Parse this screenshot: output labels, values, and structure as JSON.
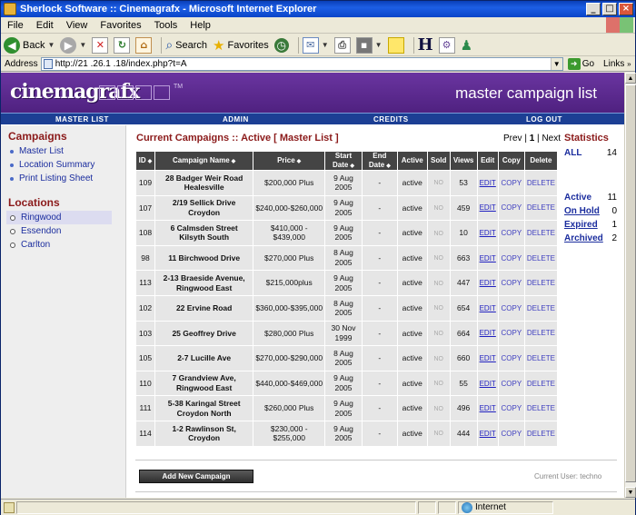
{
  "window": {
    "title": "Sherlock Software :: Cinemagrafx - Microsoft Internet Explorer"
  },
  "menu": [
    "File",
    "Edit",
    "View",
    "Favorites",
    "Tools",
    "Help"
  ],
  "toolbar": {
    "back_label": "Back",
    "search_label": "Search",
    "favorites_label": "Favorites"
  },
  "address": {
    "label": "Address",
    "url": "http://21  .26.1    .18/index.php?t=A",
    "go_label": "Go",
    "links_label": "Links"
  },
  "header": {
    "logo": "cinemagrafx",
    "tm": "TM",
    "page_title": "master campaign list"
  },
  "nav": {
    "master_list": "MASTER LIST",
    "admin": "ADMIN",
    "credits": "CREDITS",
    "logout": "LOG OUT"
  },
  "sidebar": {
    "campaigns_heading": "Campaigns",
    "campaign_links": [
      "Master List",
      "Location Summary",
      "Print Listing Sheet"
    ],
    "locations_heading": "Locations",
    "locations": [
      "Ringwood",
      "Essendon",
      "Carlton"
    ]
  },
  "main": {
    "title": "Current Campaigns :: Active [ Master List ]",
    "pager": {
      "prev": "Prev",
      "sep1": " | ",
      "current": "1",
      "sep2": " | ",
      "next": "Next"
    },
    "columns": [
      "ID",
      "Campaign Name",
      "Price",
      "Start Date",
      "End Date",
      "Active",
      "Sold",
      "Views",
      "Edit",
      "Copy",
      "Delete"
    ],
    "rows": [
      {
        "id": "109",
        "name": "28 Badger Weir Road Healesville",
        "price": "$200,000 Plus",
        "start": "9 Aug 2005",
        "end": "-",
        "active": "active",
        "sold": "NO",
        "views": "53"
      },
      {
        "id": "107",
        "name": "2/19 Sellick Drive Croydon",
        "price": "$240,000-$260,000",
        "start": "9 Aug 2005",
        "end": "-",
        "active": "active",
        "sold": "NO",
        "views": "459"
      },
      {
        "id": "108",
        "name": "6 Calmsden Street Kilsyth South",
        "price": "$410,000 - $439,000",
        "start": "9 Aug 2005",
        "end": "-",
        "active": "active",
        "sold": "NO",
        "views": "10"
      },
      {
        "id": "98",
        "name": "11 Birchwood Drive",
        "price": "$270,000 Plus",
        "start": "8 Aug 2005",
        "end": "-",
        "active": "active",
        "sold": "NO",
        "views": "663"
      },
      {
        "id": "113",
        "name": "2-13 Braeside Avenue, Ringwood East",
        "price": "$215,000plus",
        "start": "9 Aug 2005",
        "end": "-",
        "active": "active",
        "sold": "NO",
        "views": "447"
      },
      {
        "id": "102",
        "name": "22 Ervine Road",
        "price": "$360,000-$395,000",
        "start": "8 Aug 2005",
        "end": "-",
        "active": "active",
        "sold": "NO",
        "views": "654"
      },
      {
        "id": "103",
        "name": "25 Geoffrey Drive",
        "price": "$280,000 Plus",
        "start": "30 Nov 1999",
        "end": "-",
        "active": "active",
        "sold": "NO",
        "views": "664"
      },
      {
        "id": "105",
        "name": "2-7 Lucille Ave",
        "price": "$270,000-$290,000",
        "start": "8 Aug 2005",
        "end": "-",
        "active": "active",
        "sold": "NO",
        "views": "660"
      },
      {
        "id": "110",
        "name": "7 Grandview Ave, Ringwood East",
        "price": "$440,000-$469,000",
        "start": "9 Aug 2005",
        "end": "-",
        "active": "active",
        "sold": "NO",
        "views": "55"
      },
      {
        "id": "111",
        "name": "5-38 Karingal Street Croydon North",
        "price": "$260,000 Plus",
        "start": "9 Aug 2005",
        "end": "-",
        "active": "active",
        "sold": "NO",
        "views": "496"
      },
      {
        "id": "114",
        "name": "1-2 Rawlinson St, Croydon",
        "price": "$230,000 - $255,000",
        "start": "9 Aug 2005",
        "end": "-",
        "active": "active",
        "sold": "NO",
        "views": "444"
      }
    ],
    "edit_label": "EDIT",
    "copy_label": "COPY",
    "delete_label": "DELETE",
    "add_button": "Add New Campaign",
    "current_user": "Current User: techno"
  },
  "stats": {
    "heading": "Statistics",
    "all_label": "ALL",
    "all_value": "14",
    "active_label": "Active",
    "active_value": "11",
    "onhold_label": "On Hold",
    "onhold_value": "0",
    "expired_label": "Expired",
    "expired_value": "1",
    "archived_label": "Archived",
    "archived_value": "2"
  },
  "status": {
    "zone": "Internet"
  },
  "colors": {
    "header_purple": "#5a2a8c",
    "nav_blue": "#1c3f94",
    "heading_red": "#8b1a1a",
    "link_blue": "#1b2d9e"
  }
}
